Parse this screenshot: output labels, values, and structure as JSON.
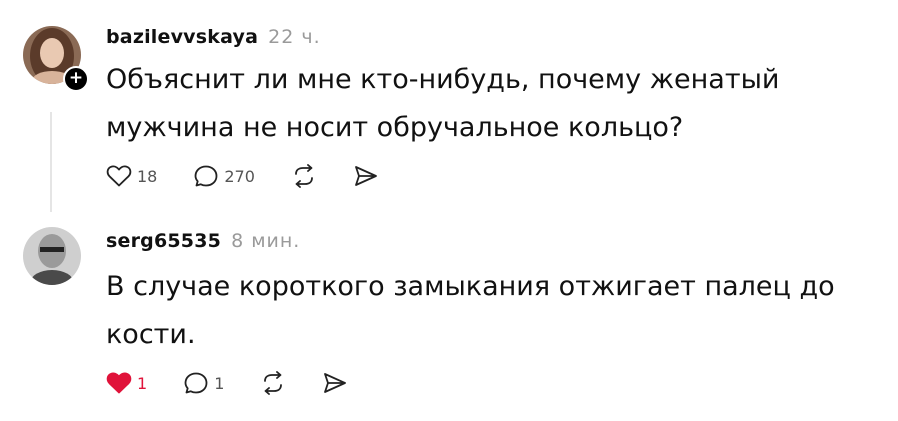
{
  "posts": [
    {
      "username": "bazilevvskaya",
      "time": "22 ч.",
      "text": "Объяснит ли мне кто-нибудь, почему женатый мужчина не носит обручальное кольцо?",
      "likes": "18",
      "replies": "270",
      "liked": false,
      "follow_badge": "+"
    },
    {
      "username": "serg65535",
      "time": "8 мин.",
      "text": "В случае короткого замыкания отжигает палец до кости.",
      "likes": "1",
      "replies": "1",
      "liked": true
    }
  ],
  "icons": {
    "like": "heart-icon",
    "reply": "speech-bubble-icon",
    "repost": "repost-icon",
    "share": "send-icon"
  },
  "colors": {
    "liked": "#e0133a",
    "muted": "#9a9a9a"
  }
}
